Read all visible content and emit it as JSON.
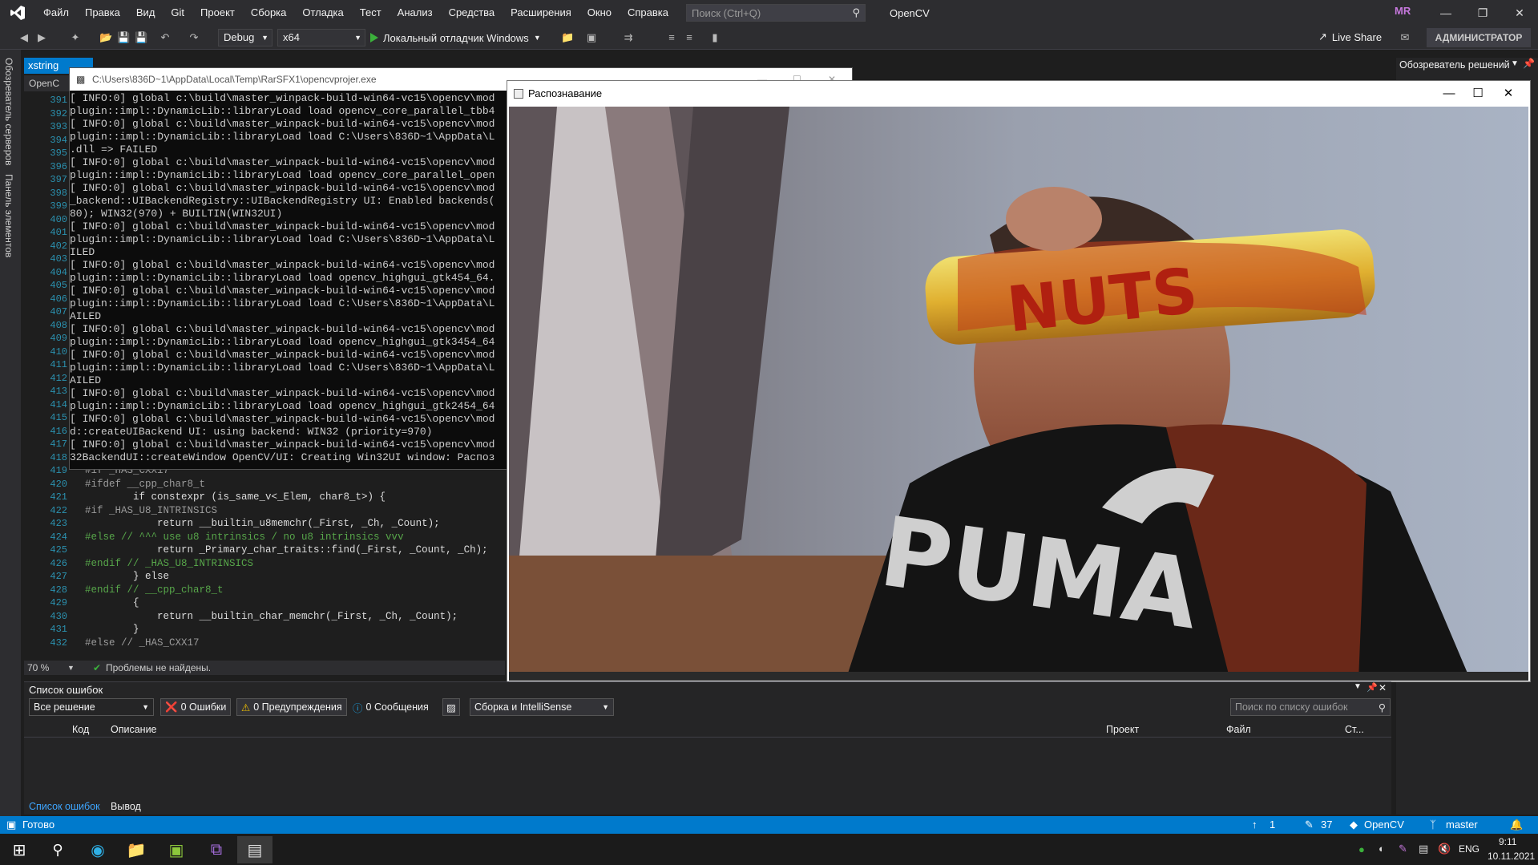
{
  "menu": {
    "items": [
      "Файл",
      "Правка",
      "Вид",
      "Git",
      "Проект",
      "Сборка",
      "Отладка",
      "Тест",
      "Анализ",
      "Средства",
      "Расширения",
      "Окно",
      "Справка"
    ],
    "search_placeholder": "Поиск (Ctrl+Q)",
    "solution_name": "OpenCV",
    "user_initials": "MR"
  },
  "toolbar": {
    "config": "Debug",
    "platform": "x64",
    "debugger": "Локальный отладчик Windows",
    "live_share": "Live Share",
    "admin": "АДМИНИСТРАТОР"
  },
  "left_tabs": [
    "Обозреватель серверов",
    "Панель элементов"
  ],
  "editor": {
    "doc_tab": "xstring",
    "nav_label": "OpenC",
    "zoom": "70 %",
    "problems": "Проблемы не найдены.",
    "line_numbers": [
      "391",
      "392",
      "393",
      "394",
      "395",
      "396",
      "397",
      "398",
      "399",
      "400",
      "401",
      "402",
      "403",
      "404",
      "405",
      "406",
      "407",
      "408",
      "409",
      "410",
      "411",
      "412",
      "413",
      "414",
      "415",
      "416",
      "417",
      "418",
      "419",
      "420",
      "421",
      "422",
      "423",
      "424",
      "425",
      "426",
      "427",
      "428",
      "429",
      "430",
      "431",
      "432"
    ],
    "code": [
      {
        "n": "419",
        "text": "#if _HAS_CXX17",
        "cls": "pp"
      },
      {
        "n": "420",
        "text": "#ifdef __cpp_char8_t",
        "cls": "pp"
      },
      {
        "n": "421",
        "text": "        if constexpr (is_same_v<_Elem, char8_t>) {",
        "cls": ""
      },
      {
        "n": "422",
        "text": "#if _HAS_U8_INTRINSICS",
        "cls": "pp"
      },
      {
        "n": "423",
        "text": "            return __builtin_u8memchr(_First, _Ch, _Count);",
        "cls": ""
      },
      {
        "n": "424",
        "text": "#else // ^^^ use u8 intrinsics / no u8 intrinsics vvv",
        "cls": "cm"
      },
      {
        "n": "425",
        "text": "            return _Primary_char_traits::find(_First, _Count, _Ch);",
        "cls": ""
      },
      {
        "n": "426",
        "text": "#endif // _HAS_U8_INTRINSICS",
        "cls": "cm"
      },
      {
        "n": "427",
        "text": "        } else",
        "cls": ""
      },
      {
        "n": "428",
        "text": "#endif // __cpp_char8_t",
        "cls": "cm"
      },
      {
        "n": "429",
        "text": "        {",
        "cls": ""
      },
      {
        "n": "430",
        "text": "            return __builtin_char_memchr(_First, _Ch, _Count);",
        "cls": ""
      },
      {
        "n": "431",
        "text": "        }",
        "cls": ""
      },
      {
        "n": "432",
        "text": "#else // _HAS_CXX17",
        "cls": "pp"
      }
    ]
  },
  "console": {
    "title": "C:\\Users\\836D~1\\AppData\\Local\\Temp\\RarSFX1\\opencvprojer.exe",
    "lines": [
      "[ INFO:0] global c:\\build\\master_winpack-build-win64-vc15\\opencv\\mod",
      "plugin::impl::DynamicLib::libraryLoad load opencv_core_parallel_tbb4",
      "[ INFO:0] global c:\\build\\master_winpack-build-win64-vc15\\opencv\\mod",
      "plugin::impl::DynamicLib::libraryLoad load C:\\Users\\836D~1\\AppData\\L",
      ".dll => FAILED",
      "[ INFO:0] global c:\\build\\master_winpack-build-win64-vc15\\opencv\\mod",
      "plugin::impl::DynamicLib::libraryLoad load opencv_core_parallel_open",
      "[ INFO:0] global c:\\build\\master_winpack-build-win64-vc15\\opencv\\mod",
      "_backend::UIBackendRegistry::UIBackendRegistry UI: Enabled backends(",
      "80); WIN32(970) + BUILTIN(WIN32UI)",
      "[ INFO:0] global c:\\build\\master_winpack-build-win64-vc15\\opencv\\mod",
      "plugin::impl::DynamicLib::libraryLoad load C:\\Users\\836D~1\\AppData\\L",
      "ILED",
      "[ INFO:0] global c:\\build\\master_winpack-build-win64-vc15\\opencv\\mod",
      "plugin::impl::DynamicLib::libraryLoad load opencv_highgui_gtk454_64.",
      "[ INFO:0] global c:\\build\\master_winpack-build-win64-vc15\\opencv\\mod",
      "plugin::impl::DynamicLib::libraryLoad load C:\\Users\\836D~1\\AppData\\L",
      "AILED",
      "[ INFO:0] global c:\\build\\master_winpack-build-win64-vc15\\opencv\\mod",
      "plugin::impl::DynamicLib::libraryLoad load opencv_highgui_gtk3454_64",
      "[ INFO:0] global c:\\build\\master_winpack-build-win64-vc15\\opencv\\mod",
      "plugin::impl::DynamicLib::libraryLoad load C:\\Users\\836D~1\\AppData\\L",
      "AILED",
      "[ INFO:0] global c:\\build\\master_winpack-build-win64-vc15\\opencv\\mod",
      "plugin::impl::DynamicLib::libraryLoad load opencv_highgui_gtk2454_64",
      "[ INFO:0] global c:\\build\\master_winpack-build-win64-vc15\\opencv\\mod",
      "d::createUIBackend UI: using backend: WIN32 (priority=970)",
      "[ INFO:0] global c:\\build\\master_winpack-build-win64-vc15\\opencv\\mod",
      "32BackendUI::createWindow OpenCV/UI: Creating Win32UI window: Распоз"
    ]
  },
  "recognition_window": {
    "title": "Распознавание",
    "shirt_text": "PUMA",
    "candy_text": "NUTS"
  },
  "error_list": {
    "title": "Список ошибок",
    "scope": "Все решение",
    "errors": "0 Ошибки",
    "warnings": "0 Предупреждения",
    "messages": "0 Сообщения",
    "build_filter": "Сборка и IntelliSense",
    "search_placeholder": "Поиск по списку ошибок",
    "columns": [
      "Код",
      "Описание",
      "Проект",
      "Файл",
      "Ст..."
    ],
    "bottom_tabs": [
      "Список ошибок",
      "Вывод"
    ]
  },
  "right_panel": {
    "title": "Обозреватель решений"
  },
  "statusbar": {
    "ready": "Готово",
    "up": "1",
    "edits": "37",
    "repo": "OpenCV",
    "branch": "master"
  },
  "taskbar": {
    "lang": "ENG",
    "time": "9:11",
    "date": "10.11.2021"
  },
  "colors": {
    "accent": "#007acc",
    "bg": "#1e1e1e",
    "chrome": "#2d2d30"
  }
}
